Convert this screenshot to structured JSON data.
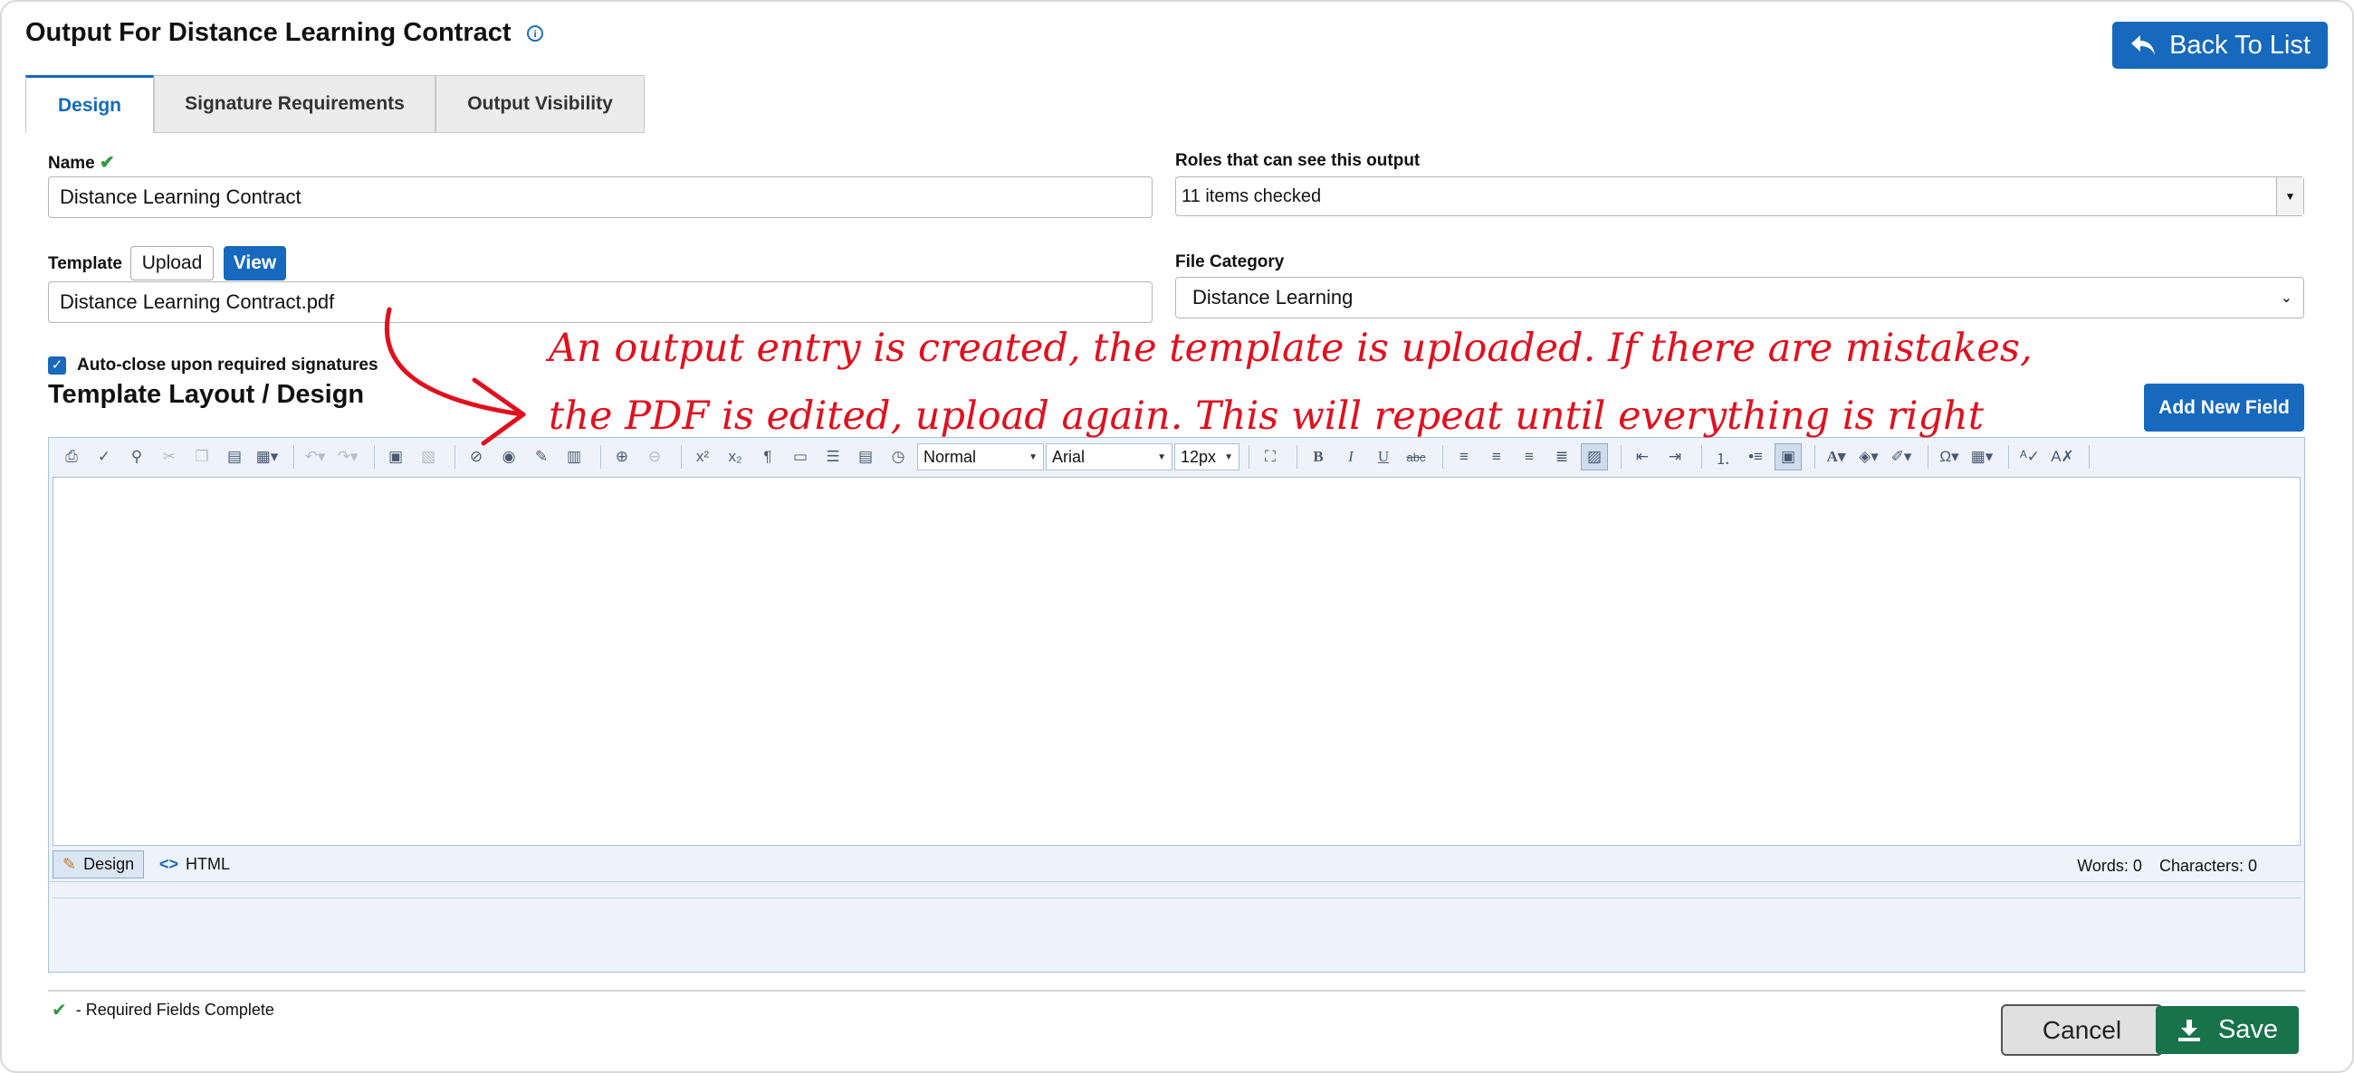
{
  "header": {
    "title": "Output For Distance Learning Contract",
    "back_label": "Back To List"
  },
  "tabs": [
    {
      "label": "Design",
      "active": true
    },
    {
      "label": "Signature Requirements",
      "active": false
    },
    {
      "label": "Output Visibility",
      "active": false
    }
  ],
  "form": {
    "name_label": "Name",
    "name_value": "Distance Learning Contract",
    "roles_label": "Roles that can see this output",
    "roles_value": "11 items checked",
    "template_label": "Template",
    "upload_label": "Upload",
    "view_label": "View",
    "template_value": "Distance Learning Contract.pdf",
    "file_category_label": "File Category",
    "file_category_value": "Distance Learning",
    "autoclose_label": "Auto-close upon required signatures",
    "autoclose_checked": true
  },
  "layout_section": {
    "title": "Template Layout / Design",
    "add_field_label": "Add New Field"
  },
  "editor": {
    "format_select": "Normal",
    "font_select": "Arial",
    "size_select": "12px",
    "design_mode_label": "Design",
    "html_mode_label": "HTML",
    "words_label": "Words: 0",
    "characters_label": "Characters: 0"
  },
  "footer": {
    "required_note": "- Required Fields Complete",
    "cancel_label": "Cancel",
    "save_label": "Save"
  },
  "annotation": {
    "line1": "An output entry is created, the template is uploaded. If there are mistakes,",
    "line2": "the PDF is edited, upload again. This will repeat until everything is right"
  },
  "colors": {
    "primary": "#1669bc",
    "save": "#18724a",
    "annotation": "#e0101e",
    "check": "#2e9a3c"
  }
}
